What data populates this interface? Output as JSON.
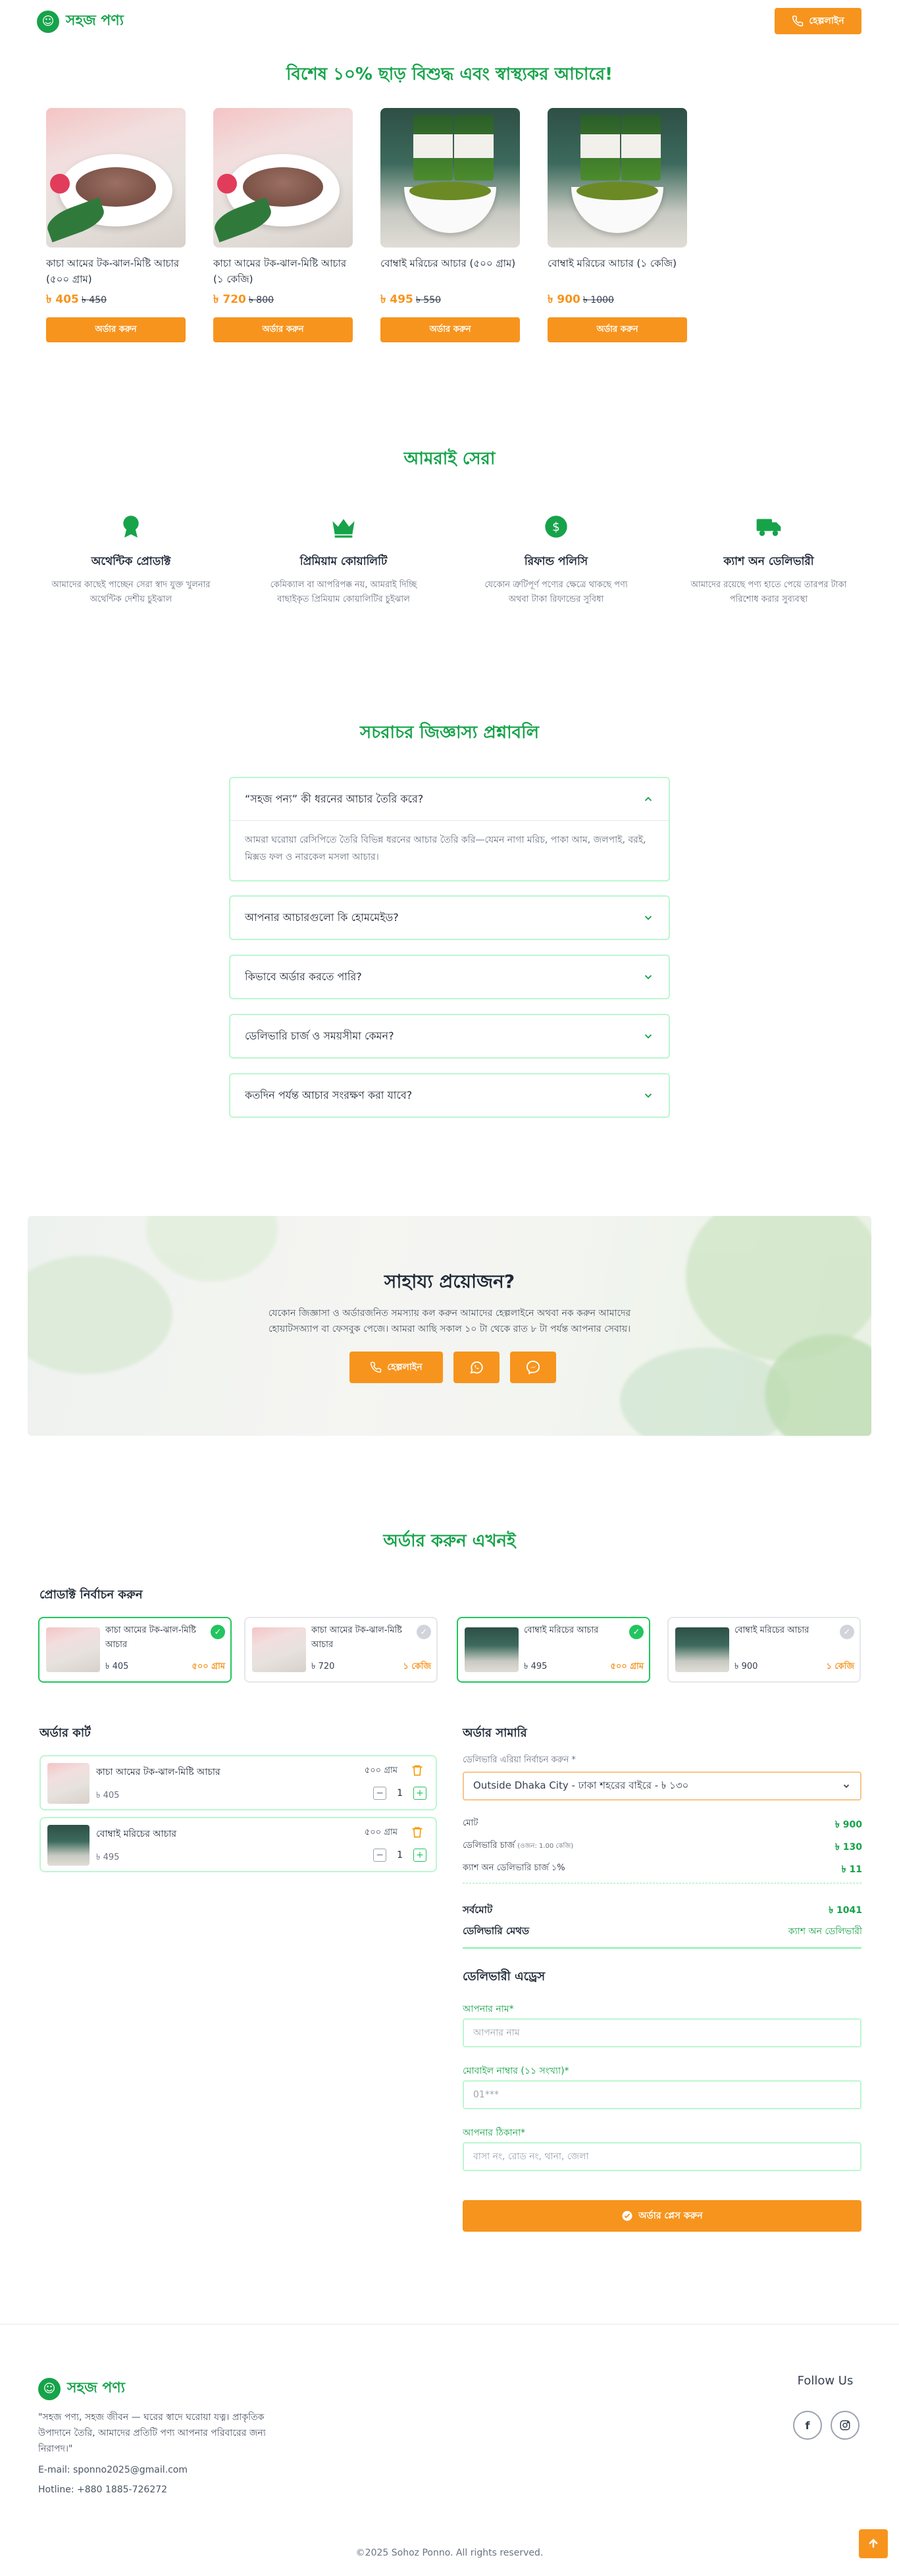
{
  "brand": {
    "name": "সহজ পণ্য",
    "logo_glyph": "☺"
  },
  "header": {
    "phone_button": "হেল্পলাইন"
  },
  "offer": {
    "title": "বিশেষ ১০% ছাড় বিশুদ্ধ এবং স্বাস্থ্যকর আচারে!",
    "products": [
      {
        "name": "কাচা আমের টক-ঝাল-মিষ্টি আচার (৫০০ গ্রাম)",
        "price": "৳ 405",
        "old_price": "৳ 450",
        "button": "অর্ডার করুন",
        "image": "paste"
      },
      {
        "name": "কাচা আমের টক-ঝাল-মিষ্টি আচার (১ কেজি)",
        "price": "৳ 720",
        "old_price": "৳ 800",
        "button": "অর্ডার করুন",
        "image": "paste"
      },
      {
        "name": "বোম্বাই মরিচের আচার (৫০০ গ্রাম)",
        "price": "৳ 495",
        "old_price": "৳ 550",
        "button": "অর্ডার করুন",
        "image": "jar"
      },
      {
        "name": "বোম্বাই মরিচের আচার (১ কেজি)",
        "price": "৳ 900",
        "old_price": "৳ 1000",
        "button": "অর্ডার করুন",
        "image": "jar"
      }
    ]
  },
  "why": {
    "title": "আমরাই সেরা",
    "features": [
      {
        "icon": "certificate-icon",
        "title": "অথেন্টিক প্রোডাক্ট",
        "desc": "আমাদের কাছেই পাচ্ছেন সেরা স্বাদ যুক্ত খুলনার অথেন্টিক দেশীয় চুইঝাল"
      },
      {
        "icon": "crown-icon",
        "title": "প্রিমিয়াম কোয়ালিটি",
        "desc": "কেমিক্যাল বা আপরিপক্ক নয়, আমরাই দিচ্ছি বাছাইকৃত প্রিমিয়াম কোয়ালিটির চুইঝাল"
      },
      {
        "icon": "refund-icon",
        "title": "রিফান্ড পলিসি",
        "desc": "যেকোন ত্রুটিপূর্ণ পণ্যের ক্ষেত্রে থাকছে পণ্য অথবা টাকা রিফান্ডের সুবিধা"
      },
      {
        "icon": "truck-icon",
        "title": "ক্যাশ অন ডেলিভারী",
        "desc": "আমাদের রয়েছে পণ্য হাতে পেয়ে তারপর টাকা পরিশোধ করার সুব্যবস্থা"
      }
    ]
  },
  "faq": {
    "title": "সচরাচর জিজ্ঞাস্য প্রশ্নাবলি",
    "items": [
      {
        "q": "“সহজ পন্য” কী ধরনের আচার তৈরি করে?",
        "a": "আমরা ঘরোয়া রেসিপিতে তৈরি বিভিন্ন ধরনের আচার তৈরি করি—যেমন নাগা মরিচ, পাকা আম, জলপাই, বরই, মিক্সড ফল ও নারকেল মসলা আচার।",
        "open": true
      },
      {
        "q": "আপনার আচারগুলো কি হোমমেইড?",
        "a": "",
        "open": false
      },
      {
        "q": "কিভাবে অর্ডার করতে পারি?",
        "a": "",
        "open": false
      },
      {
        "q": "ডেলিভারি চার্জ ও সময়সীমা কেমন?",
        "a": "",
        "open": false
      },
      {
        "q": "কতদিন পর্যন্ত আচার সংরক্ষণ করা যাবে?",
        "a": "",
        "open": false
      }
    ]
  },
  "help": {
    "title": "সাহায্য প্রয়োজন?",
    "desc": "যেকোন জিজ্ঞাসা ও অর্ডারজনিত সমস্যায় কল করুন আমাদের হেল্পলাইনে অথবা নক করুন আমাদের হোয়াটসঅ্যাপ বা ফেসবুক পেজে। আমরা আছি সকাল ১০ টা থেকে রাত ৮ টা পর্যন্ত আপনার সেবায়।",
    "phone_button": "হেল্পলাইন"
  },
  "order": {
    "title": "অর্ডার করুন এখনই",
    "select_title": "প্রোডাক্ট নির্বাচন করুন",
    "picks": [
      {
        "name": "কাচা আমের টক-ঝাল-মিষ্টি আচার",
        "price": "৳ 405",
        "weight": "৫০০ গ্রাম",
        "selected": true,
        "image": "paste"
      },
      {
        "name": "কাচা আমের টক-ঝাল-মিষ্টি আচার",
        "price": "৳ 720",
        "weight": "১ কেজি",
        "selected": false,
        "image": "paste"
      },
      {
        "name": "বোম্বাই মরিচের আচার",
        "price": "৳ 495",
        "weight": "৫০০ গ্রাম",
        "selected": true,
        "image": "jar"
      },
      {
        "name": "বোম্বাই মরিচের আচার",
        "price": "৳ 900",
        "weight": "১ কেজি",
        "selected": false,
        "image": "jar"
      }
    ],
    "cart_title": "অর্ডার কার্ট",
    "cart": [
      {
        "name": "কাচা আমের টক-ঝাল-মিষ্টি আচার",
        "price": "৳ 405",
        "weight": "৫০০ গ্রাম",
        "qty": "1",
        "image": "paste"
      },
      {
        "name": "বোম্বাই মরিচের আচার",
        "price": "৳ 495",
        "weight": "৫০০ গ্রাম",
        "qty": "1",
        "image": "jar"
      }
    ],
    "summary": {
      "title": "অর্ডার সামারি",
      "area_label": "ডেলিভারি এরিয়া নির্বাচন করুন *",
      "area_value": "Outside Dhaka City - ঢাকা শহরের বাইরে - ৳ ১৩০",
      "subtotal_label": "মোট",
      "subtotal": "৳ 900",
      "delivery_label": "ডেলিভারি চার্জ",
      "delivery_note": "(ওজন: 1.00 কেজি)",
      "delivery": "৳ 130",
      "cod_label": "ক্যাশ অন ডেলিভারি চার্জ ১%",
      "cod": "৳ 11",
      "total_label": "সর্বমোট",
      "total": "৳ 1041",
      "method_label": "ডেলিভারি মেথড",
      "method": "ক্যাশ অন ডেলিভারী"
    },
    "address": {
      "title": "ডেলিভারী এড্রেস",
      "name_label": "আপনার নাম*",
      "name_placeholder": "আপনার নাম",
      "phone_label": "মোবাইল নাম্বার (১১ সংখ্যা)*",
      "phone_placeholder": "01***",
      "addr_label": "আপনার ঠিকানা*",
      "addr_placeholder": "বাসা নং, রোড নং, থানা, জেলা"
    },
    "place_button": "অর্ডার প্লেস করুন"
  },
  "footer": {
    "tagline": "\"সহজ পণ্য, সহজ জীবন — ঘরের স্বাদে ঘরোয়া যত্ন। প্রাকৃতিক উপাদানে তৈরি, আমাদের প্রতিটি পণ্য আপনার পরিবারের জন্য নিরাপদ।\"",
    "email": "E-mail: sponno2025@gmail.com",
    "hotline": "Hotline: +880 1885-726272",
    "follow": "Follow Us",
    "copyright": "©2025 Sohoz Ponno. All rights reserved."
  },
  "colors": {
    "green": "#16a34a",
    "orange": "#f7941d"
  }
}
